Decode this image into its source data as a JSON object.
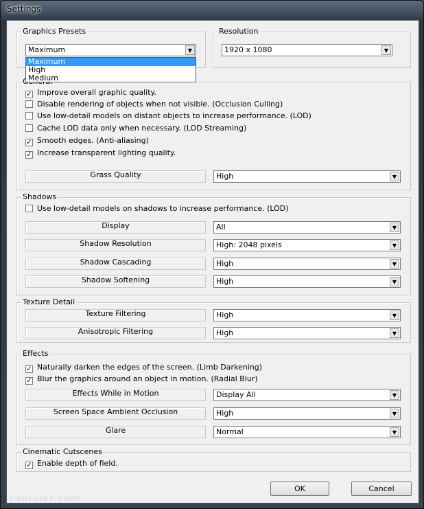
{
  "window": {
    "title": "Settings"
  },
  "presets": {
    "legend": "Graphics Presets",
    "value": "Maximum",
    "options": [
      "Maximum",
      "High",
      "Medium"
    ],
    "selected_option": "Maximum"
  },
  "resolution": {
    "legend": "Resolution",
    "value": "1920 x 1080"
  },
  "general": {
    "legend": "General",
    "checks": [
      {
        "label": "Improve overall graphic quality.",
        "checked": true
      },
      {
        "label": "Disable rendering of objects when not visible. (Occlusion Culling)",
        "checked": false
      },
      {
        "label": "Use low-detail models on distant objects to increase performance. (LOD)",
        "checked": false
      },
      {
        "label": "Cache LOD data only when necessary. (LOD Streaming)",
        "checked": false
      },
      {
        "label": "Smooth edges. (Anti-aliasing)",
        "checked": true
      },
      {
        "label": "Increase transparent lighting quality.",
        "checked": true
      }
    ],
    "rows": [
      {
        "label": "Grass Quality",
        "value": "High"
      }
    ]
  },
  "shadows": {
    "legend": "Shadows",
    "checks": [
      {
        "label": "Use low-detail models on shadows to increase performance. (LOD)",
        "checked": false
      }
    ],
    "rows": [
      {
        "label": "Display",
        "value": "All"
      },
      {
        "label": "Shadow Resolution",
        "value": "High: 2048 pixels"
      },
      {
        "label": "Shadow Cascading",
        "value": "High"
      },
      {
        "label": "Shadow Softening",
        "value": "High"
      }
    ]
  },
  "texture": {
    "legend": "Texture Detail",
    "rows": [
      {
        "label": "Texture Filtering",
        "value": "High"
      },
      {
        "label": "Anisotropic Filtering",
        "value": "High"
      }
    ]
  },
  "effects": {
    "legend": "Effects",
    "checks": [
      {
        "label": "Naturally darken the edges of the screen. (Limb Darkening)",
        "checked": true
      },
      {
        "label": "Blur the graphics around an object in motion. (Radial Blur)",
        "checked": true
      }
    ],
    "rows": [
      {
        "label": "Effects While in Motion",
        "value": "Display All"
      },
      {
        "label": "Screen Space Ambient Occlusion",
        "value": "High"
      },
      {
        "label": "Glare",
        "value": "Normal"
      }
    ]
  },
  "cinematic": {
    "legend": "Cinematic Cutscenes",
    "checks": [
      {
        "label": "Enable depth of field.",
        "checked": true
      }
    ]
  },
  "buttons": {
    "ok": "OK",
    "cancel": "Cancel"
  },
  "watermark": "coolaler.com"
}
